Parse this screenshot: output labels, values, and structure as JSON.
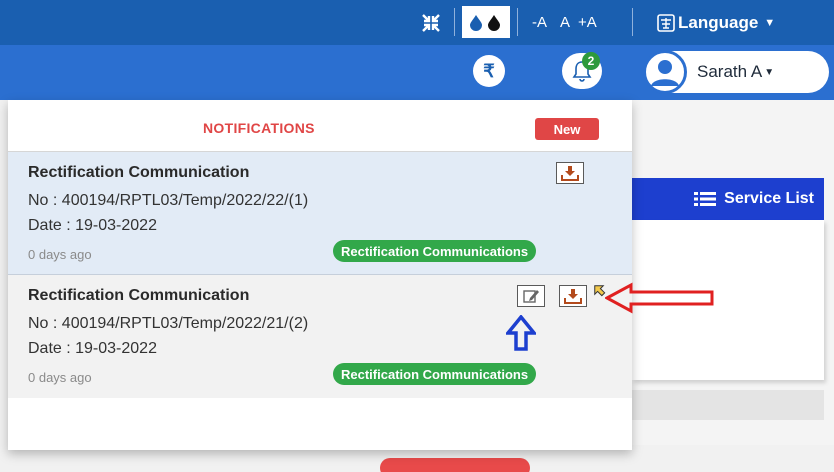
{
  "topbar": {
    "fullscreen_icon": "shrink-icon",
    "contrast_icon": "contrast-drops-icon",
    "font_decrease": "-A",
    "font_normal": "A",
    "font_increase": "+A",
    "language_label": "Language"
  },
  "header": {
    "currency_symbol": "₹",
    "notification_count": "2",
    "user_name": "Sarath A"
  },
  "page": {
    "service_list_label": "Service List"
  },
  "notifications": {
    "title": "NOTIFICATIONS",
    "new_badge": "New",
    "items": [
      {
        "title": "Rectification Communication",
        "number": "No : 400194/RPTL03/Temp/2022/22/(1)",
        "date": "Date : 19-03-2022",
        "ago": "0 days ago",
        "tag": "Rectification Communications"
      },
      {
        "title": "Rectification Communication",
        "number": "No : 400194/RPTL03/Temp/2022/21/(2)",
        "date": "Date : 19-03-2022",
        "ago": "0 days ago",
        "tag": "Rectification Communications"
      }
    ]
  },
  "colors": {
    "topbar": "#1a5fb0",
    "header": "#2b6fd0",
    "accent_red": "#e04646",
    "tag_green": "#32a84a",
    "service_blue": "#1d3fcf"
  }
}
